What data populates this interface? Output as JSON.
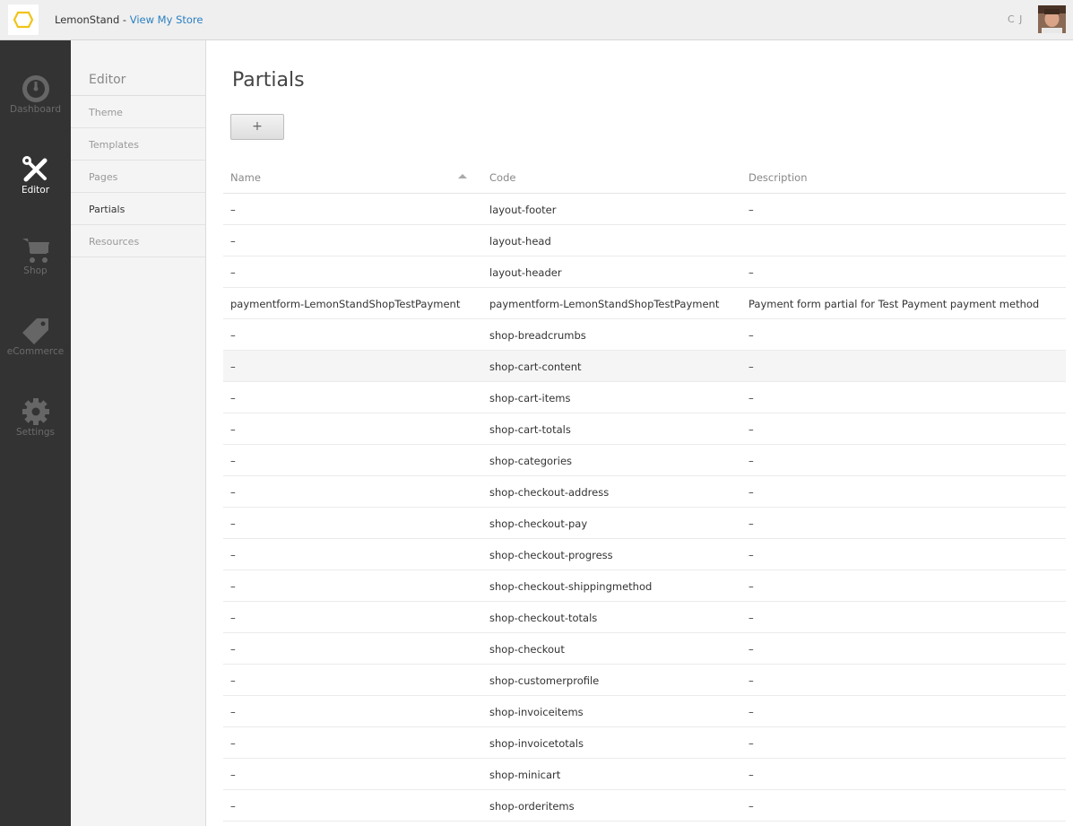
{
  "topbar": {
    "store_name": "LemonStand",
    "separator": " - ",
    "view_store_link": "View My Store",
    "user_initials": "C J"
  },
  "mainnav": [
    {
      "label": "Dashboard",
      "icon": "dashboard-icon",
      "active": false
    },
    {
      "label": "Editor",
      "icon": "editor-tools-icon",
      "active": true
    },
    {
      "label": "Shop",
      "icon": "cart-icon",
      "active": false
    },
    {
      "label": "eCommerce",
      "icon": "tag-icon",
      "active": false
    },
    {
      "label": "Settings",
      "icon": "gear-icon",
      "active": false
    }
  ],
  "subnav": {
    "title": "Editor",
    "items": [
      {
        "label": "Theme",
        "active": false
      },
      {
        "label": "Templates",
        "active": false
      },
      {
        "label": "Pages",
        "active": false
      },
      {
        "label": "Partials",
        "active": true
      },
      {
        "label": "Resources",
        "active": false
      }
    ]
  },
  "main": {
    "title": "Partials",
    "add_button_label": "+",
    "columns": [
      "Name",
      "Code",
      "Description"
    ],
    "rows": [
      {
        "name": "–",
        "code": "layout-footer",
        "description": "–"
      },
      {
        "name": "–",
        "code": "layout-head",
        "description": ""
      },
      {
        "name": "–",
        "code": "layout-header",
        "description": "–"
      },
      {
        "name": "paymentform-LemonStandShopTestPayment",
        "code": "paymentform-LemonStandShopTestPayment",
        "description": "Payment form partial for Test Payment payment method"
      },
      {
        "name": "–",
        "code": "shop-breadcrumbs",
        "description": "–"
      },
      {
        "name": "–",
        "code": "shop-cart-content",
        "description": "–"
      },
      {
        "name": "–",
        "code": "shop-cart-items",
        "description": "–"
      },
      {
        "name": "–",
        "code": "shop-cart-totals",
        "description": "–"
      },
      {
        "name": "–",
        "code": "shop-categories",
        "description": "–"
      },
      {
        "name": "–",
        "code": "shop-checkout-address",
        "description": "–"
      },
      {
        "name": "–",
        "code": "shop-checkout-pay",
        "description": "–"
      },
      {
        "name": "–",
        "code": "shop-checkout-progress",
        "description": "–"
      },
      {
        "name": "–",
        "code": "shop-checkout-shippingmethod",
        "description": "–"
      },
      {
        "name": "–",
        "code": "shop-checkout-totals",
        "description": "–"
      },
      {
        "name": "–",
        "code": "shop-checkout",
        "description": "–"
      },
      {
        "name": "–",
        "code": "shop-customerprofile",
        "description": "–"
      },
      {
        "name": "–",
        "code": "shop-invoiceitems",
        "description": "–"
      },
      {
        "name": "–",
        "code": "shop-invoicetotals",
        "description": "–"
      },
      {
        "name": "–",
        "code": "shop-minicart",
        "description": "–"
      },
      {
        "name": "–",
        "code": "shop-orderitems",
        "description": "–"
      }
    ]
  }
}
